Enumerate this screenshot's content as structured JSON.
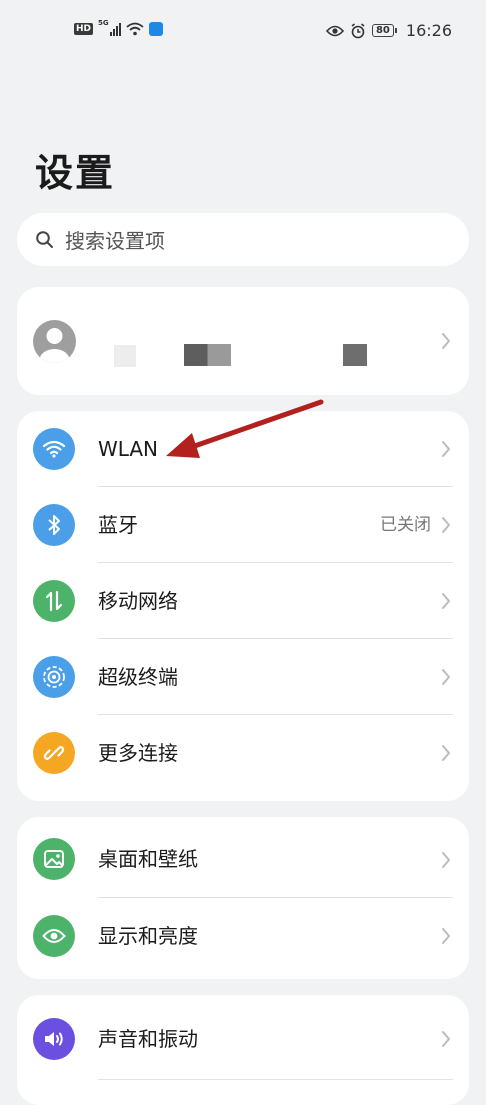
{
  "status_bar": {
    "hd": "HD",
    "network": "5G",
    "battery": "80",
    "time": "16:26"
  },
  "page_title": "设置",
  "search": {
    "placeholder": "搜索设置项"
  },
  "groups": [
    {
      "items": [
        {
          "label": "WLAN",
          "icon": "wifi-icon",
          "color": "#4a9fe8"
        },
        {
          "label": "蓝牙",
          "value": "已关闭",
          "icon": "bluetooth-icon",
          "color": "#4a9fe8"
        },
        {
          "label": "移动网络",
          "icon": "mobile-data-icon",
          "color": "#4db36a"
        },
        {
          "label": "超级终端",
          "icon": "super-device-icon",
          "color": "#4a9fe8"
        },
        {
          "label": "更多连接",
          "icon": "link-icon",
          "color": "#f5a623"
        }
      ]
    },
    {
      "items": [
        {
          "label": "桌面和壁纸",
          "icon": "wallpaper-icon",
          "color": "#4db36a"
        },
        {
          "label": "显示和亮度",
          "icon": "eye-icon",
          "color": "#4db36a"
        }
      ]
    },
    {
      "items": [
        {
          "label": "声音和振动",
          "icon": "speaker-icon",
          "color": "#6b4fe0"
        }
      ]
    }
  ],
  "annotation_color": "#b3211f"
}
